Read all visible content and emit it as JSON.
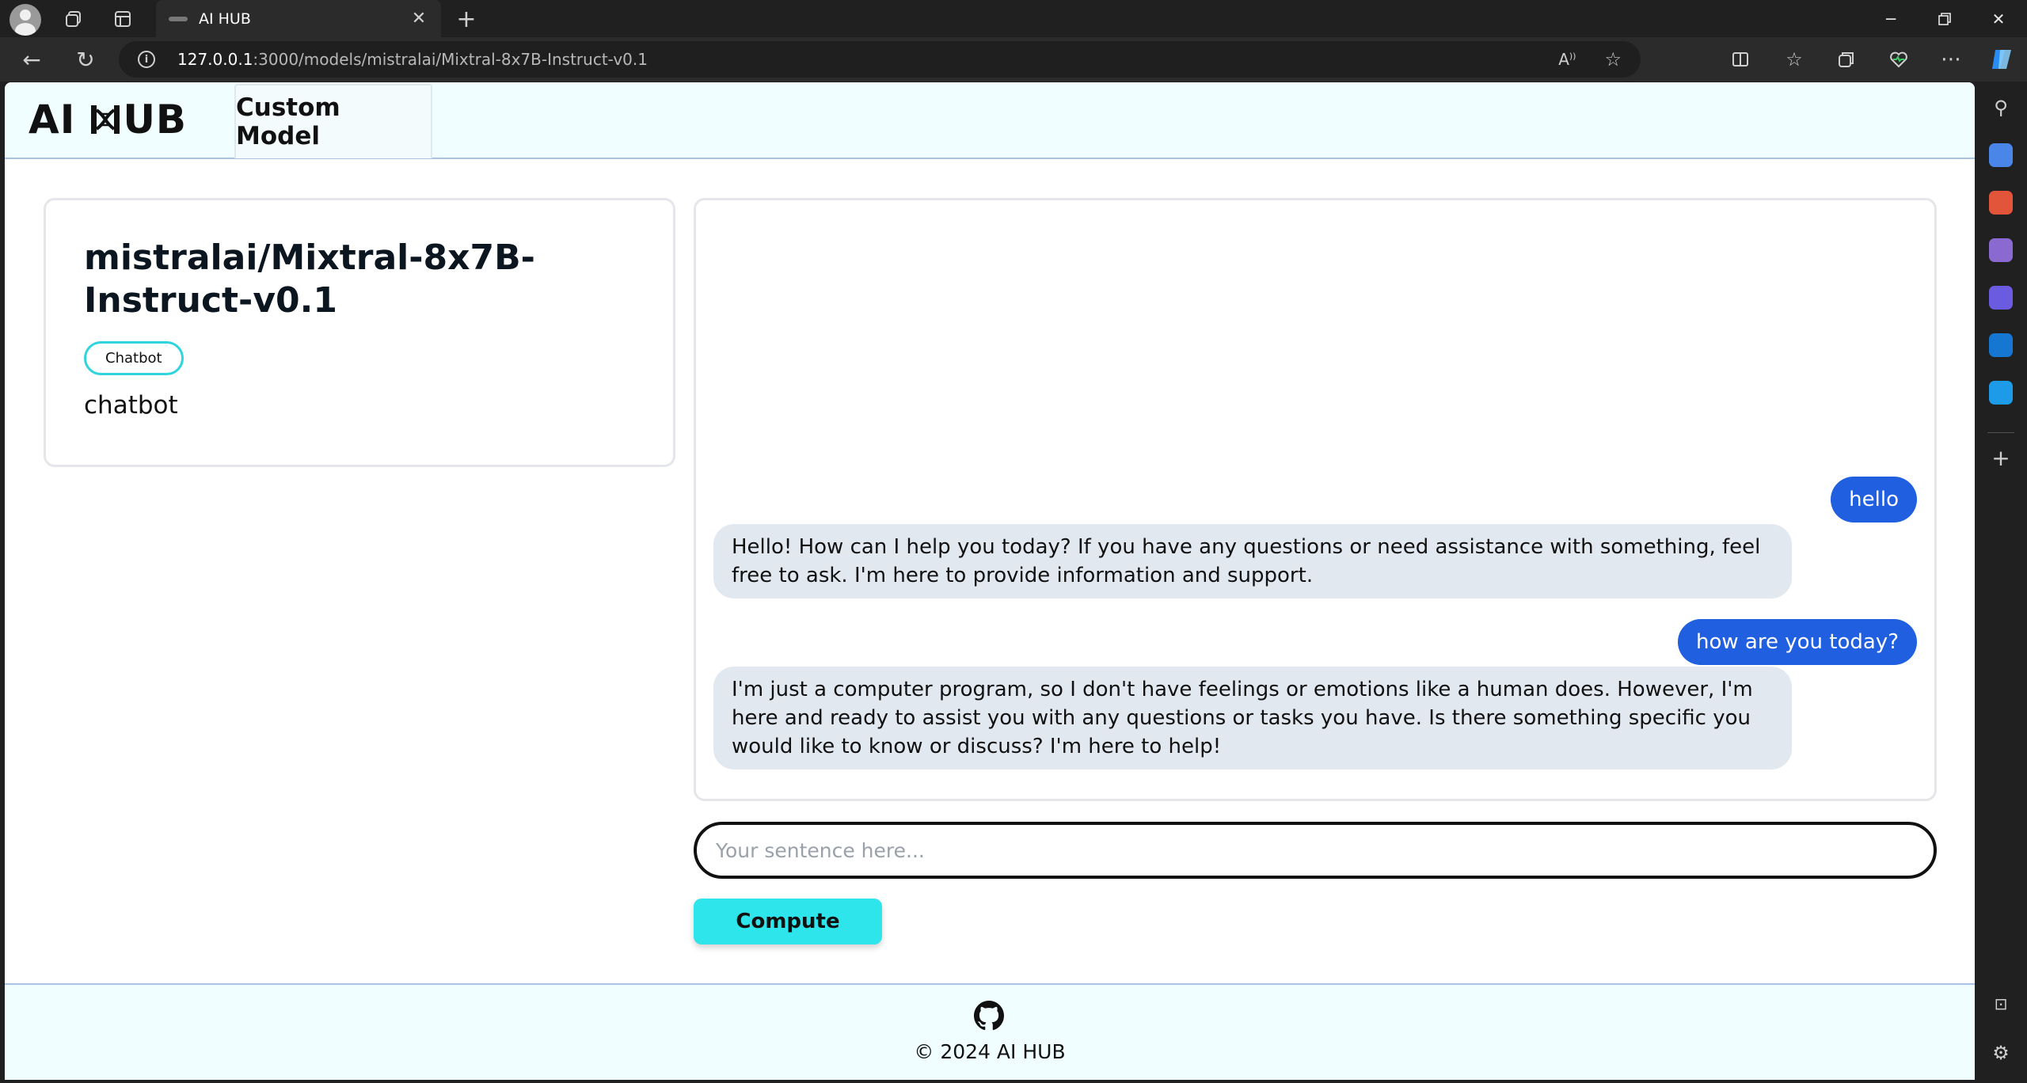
{
  "browser": {
    "tab_title": "AI HUB",
    "url_host": "127.0.0.1",
    "url_path": ":3000/models/mistralai/Mixtral-8x7B-Instruct-v0.1"
  },
  "header": {
    "logo_part1": "AI",
    "logo_part2": "UB",
    "nav_label": "Custom Model"
  },
  "model": {
    "title": "mistralai/Mixtral-8x7B-Instruct-v0.1",
    "tag": "Chatbot",
    "description": "chatbot"
  },
  "chat": {
    "messages": [
      {
        "role": "user",
        "text": "hello"
      },
      {
        "role": "assistant",
        "text": "Hello! How can I help you today? If you have any questions or need assistance with something, feel free to ask. I'm here to provide information and support."
      },
      {
        "role": "user",
        "text": "how are you today?"
      },
      {
        "role": "assistant",
        "text": "I'm just a computer program, so I don't have feelings or emotions like a human does. However, I'm here and ready to assist you with any questions or tasks you have. Is there something specific you would like to know or discuss? I'm here to help!"
      }
    ],
    "input_placeholder": "Your sentence here...",
    "input_value": "",
    "submit_label": "Compute"
  },
  "footer": {
    "github_icon": "github-icon",
    "copyright": "© 2024 AI HUB"
  },
  "colors": {
    "accent": "#2de5ea",
    "user_bubble": "#1f5fe0",
    "bot_bubble": "#e2e8f0",
    "header_bg": "#f0feff"
  }
}
